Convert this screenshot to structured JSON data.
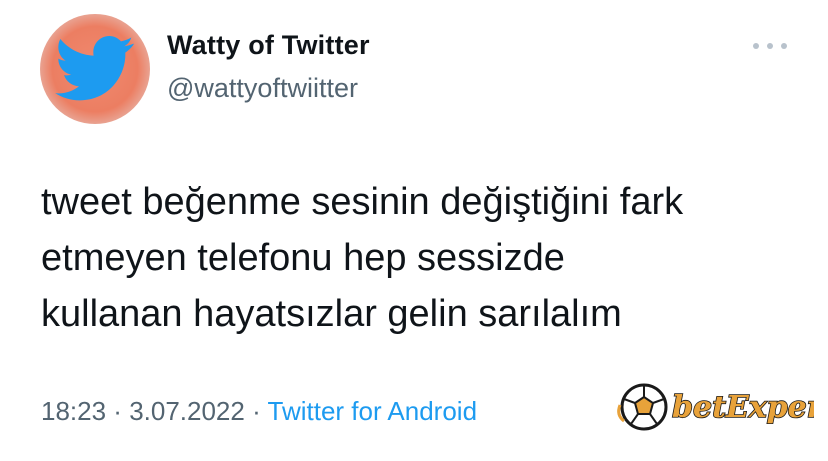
{
  "author": {
    "display_name": "Watty of Twitter",
    "handle": "@wattyoftwiitter",
    "avatar_icon": "twitter-bird-icon"
  },
  "menu": {
    "icon": "more-options-icon"
  },
  "tweet": {
    "lines": [
      "tweet beğenme sesinin değiştiğini fark",
      "etmeyen telefonu hep sessizde",
      "kullanan hayatsızlar gelin sarılalım"
    ]
  },
  "meta": {
    "time": "18:23",
    "date": "3.07.2022",
    "separator": " · ",
    "source": "Twitter for Android"
  },
  "watermark": {
    "brand": "betExper"
  },
  "colors": {
    "accent": "#1d9bf0",
    "secondary_text": "#536471",
    "avatar_bg": "#ec7e62"
  }
}
